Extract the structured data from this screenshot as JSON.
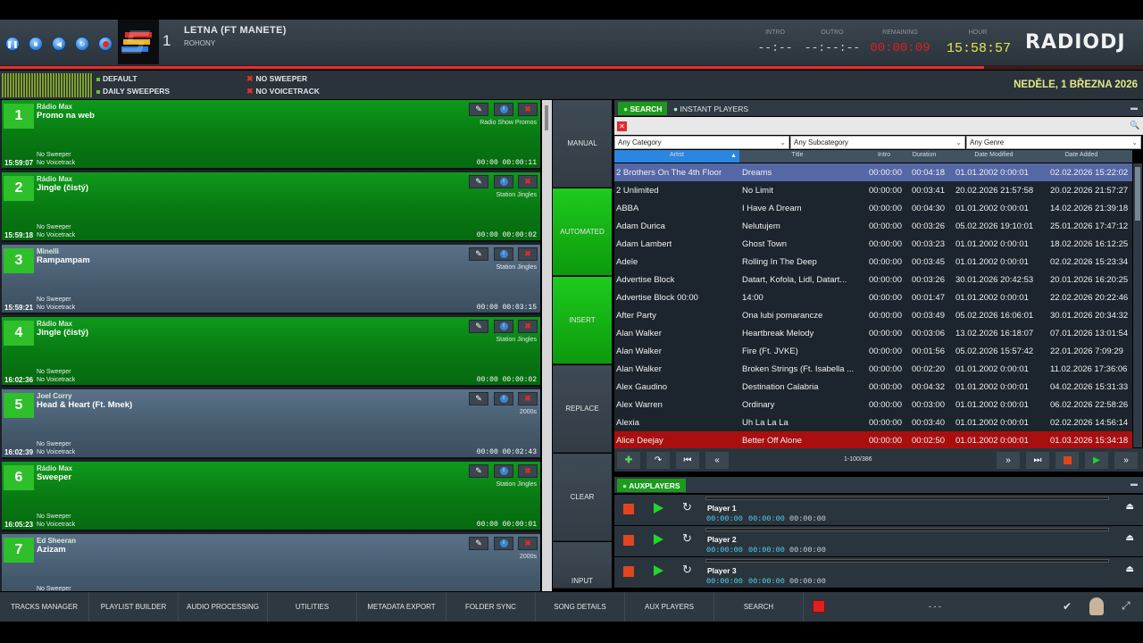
{
  "transport": {
    "pause": "pause-icon",
    "stop": "stop-icon",
    "prev": "previous-icon",
    "loop": "loop-icon",
    "record": "record-icon"
  },
  "now_playing": {
    "deck": "1",
    "title": "LETNA (FT MANETE)",
    "artist": "ROHONY"
  },
  "timers": {
    "intro_label": "INTRO",
    "intro": "--:--",
    "outro_label": "OUTRO",
    "outro": "--:--:--",
    "remaining_label": "REMAINING",
    "remaining": "00:00:09",
    "hour_label": "HOUR",
    "hour": "15:58:57"
  },
  "brand": "RADIODJ",
  "colors": {
    "accent_green": "#1d9a1d",
    "remaining": "#e01f1f",
    "hour": "#e6e74a",
    "progress": "#e03030"
  },
  "progress_fraction": 0.93,
  "status": {
    "default": "DEFAULT",
    "daily_sweepers": "DAILY SWEEPERS",
    "no_sweeper": "NO SWEEPER",
    "no_voicetrack": "NO VOICETRACK",
    "date": "NEDĚLE, 1 BŘEZNA 2026"
  },
  "playlist": [
    {
      "n": "1",
      "artist": "Rádio Max",
      "title": "Promo na web",
      "cat": "Radio Show Promos",
      "sw": "No Sweeper",
      "vt": "No Voicetrack",
      "time": "15:59:07",
      "dur": "00:00  00:00:11",
      "color": "green"
    },
    {
      "n": "2",
      "artist": "Rádio Max",
      "title": "Jingle (čistý)",
      "cat": "Station Jingles",
      "sw": "No Sweeper",
      "vt": "No Voicetrack",
      "time": "15:59:18",
      "dur": "00:00  00:00:02",
      "color": "green"
    },
    {
      "n": "3",
      "artist": "Minelli",
      "title": "Rampampam",
      "cat": "Station Jingles",
      "sw": "No Sweeper",
      "vt": "No Voicetrack",
      "time": "15:59:21",
      "dur": "00:00  00:03:15",
      "color": "blue"
    },
    {
      "n": "4",
      "artist": "Rádio Max",
      "title": "Jingle (čistý)",
      "cat": "Station Jingles",
      "sw": "No Sweeper",
      "vt": "No Voicetrack",
      "time": "16:02:36",
      "dur": "00:00  00:00:02",
      "color": "green"
    },
    {
      "n": "5",
      "artist": "Joel Corry",
      "title": "Head & Heart (Ft. Mnek)",
      "cat": "2000s",
      "sw": "No Sweeper",
      "vt": "No Voicetrack",
      "time": "16:02:39",
      "dur": "00:00  00:02:43",
      "color": "blue"
    },
    {
      "n": "6",
      "artist": "Rádio Max",
      "title": "Sweeper",
      "cat": "Station Jingles",
      "sw": "No Sweeper",
      "vt": "No Voicetrack",
      "time": "16:05:23",
      "dur": "00:00  00:00:01",
      "color": "green"
    },
    {
      "n": "7",
      "artist": "Ed Sheeran",
      "title": "Azizam",
      "cat": "2000s",
      "sw": "No Sweeper",
      "vt": "",
      "time": "",
      "dur": "",
      "color": "blue"
    }
  ],
  "modes": [
    "MANUAL",
    "AUTOMATED",
    "INSERT",
    "REPLACE",
    "CLEAR",
    "INPUT"
  ],
  "tabs": {
    "search": "SEARCH",
    "instant": "INSTANT PLAYERS"
  },
  "filters": {
    "category": "Any Category",
    "subcategory": "Any Subcategory",
    "genre": "Any Genre"
  },
  "columns": [
    "Artist",
    "Title",
    "Intro",
    "Duration",
    "Date Modified",
    "Date Added"
  ],
  "library": [
    [
      "2 Brothers On The 4th Floor",
      "Dreams",
      "00:00:00",
      "00:04:18",
      "01.01.2002 0:00:01",
      "02.02.2026 15:22:02"
    ],
    [
      "2 Unlimited",
      "No Limit",
      "00:00:00",
      "00:03:41",
      "20.02.2026 21:57:58",
      "20.02.2026 21:57:27"
    ],
    [
      "ABBA",
      "I Have A Dream",
      "00:00:00",
      "00:04:30",
      "01.01.2002 0:00:01",
      "14.02.2026 21:39:18"
    ],
    [
      "Adam Durica",
      "Nelutujem",
      "00:00:00",
      "00:03:26",
      "05.02.2026 19:10:01",
      "25.01.2026 17:47:12"
    ],
    [
      "Adam Lambert",
      "Ghost Town",
      "00:00:00",
      "00:03:23",
      "01.01.2002 0:00:01",
      "18.02.2026 16:12:25"
    ],
    [
      "Adele",
      "Rolling In The Deep",
      "00:00:00",
      "00:03:45",
      "01.01.2002 0:00:01",
      "02.02.2026 15:23:34"
    ],
    [
      "Advertise Block",
      "Datart, Kofola, Lidl, Datart...",
      "00:00:00",
      "00:03:26",
      "30.01.2026 20:42:53",
      "20.01.2026 16:20:25"
    ],
    [
      "Advertise Block 00:00",
      "14:00",
      "00:00:00",
      "00:01:47",
      "01.01.2002 0:00:01",
      "22.02.2026 20:22:46"
    ],
    [
      "After Party",
      "Ona lubi pomarancze",
      "00:00:00",
      "00:03:49",
      "05.02.2026 16:06:01",
      "30.01.2026 20:34:32"
    ],
    [
      "Alan Walker",
      "Heartbreak Melody",
      "00:00:00",
      "00:03:06",
      "13.02.2026 16:18:07",
      "07.01.2026 13:01:54"
    ],
    [
      "Alan Walker",
      "Fire (Ft. JVKE)",
      "00:00:00",
      "00:01:56",
      "05.02.2026 15:57:42",
      "22.01.2026 7:09:29"
    ],
    [
      "Alan Walker",
      "Broken Strings (Ft. Isabella ...",
      "00:00:00",
      "00:02:20",
      "01.01.2002 0:00:01",
      "11.02.2026 17:36:06"
    ],
    [
      "Alex Gaudino",
      "Destination Calabria",
      "00:00:00",
      "00:04:32",
      "01.01.2002 0:00:01",
      "04.02.2026 15:31:33"
    ],
    [
      "Alex Warren",
      "Ordinary",
      "00:00:00",
      "00:03:00",
      "01.01.2002 0:00:01",
      "06.02.2026 22:58:26"
    ],
    [
      "Alexia",
      "Uh La La La",
      "00:00:00",
      "00:03:40",
      "01.01.2002 0:00:01",
      "02.02.2026 14:56:14"
    ],
    [
      "Alice Deejay",
      "Better Off Alone",
      "00:00:00",
      "00:02:50",
      "01.01.2002 0:00:01",
      "01.03.2026 15:34:18"
    ]
  ],
  "library_count": "1-100/386",
  "aux": {
    "header": "AUXPLAYERS",
    "players": [
      {
        "name": "Player 1",
        "t1": "00:00:00",
        "t2": "00:00:00",
        "t3": "00:00:00"
      },
      {
        "name": "Player 2",
        "t1": "00:00:00",
        "t2": "00:00:00",
        "t3": "00:00:00"
      },
      {
        "name": "Player 3",
        "t1": "00:00:00",
        "t2": "00:00:00",
        "t3": "00:00:00"
      }
    ]
  },
  "bottom": [
    "TRACKS MANAGER",
    "PLAYLIST BUILDER",
    "AUDIO PROCESSING",
    "UTILITIES",
    "METADATA EXPORT",
    "FOLDER SYNC",
    "SONG DETAILS",
    "AUX PLAYERS",
    "SEARCH"
  ],
  "bottom_status": "- - -"
}
